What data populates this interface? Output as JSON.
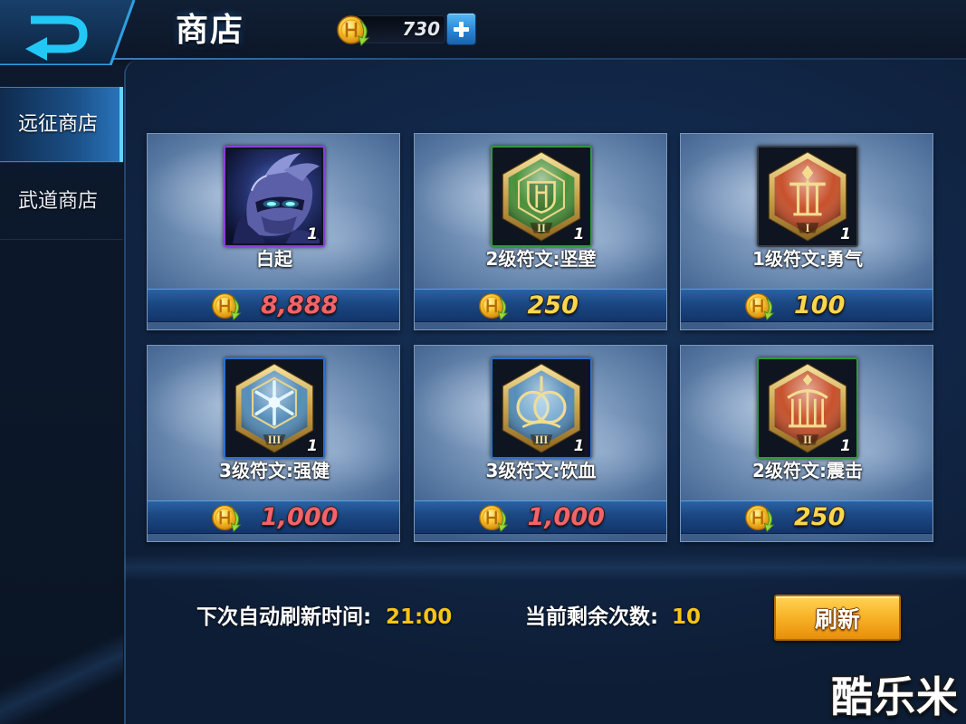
{
  "header": {
    "title": "商店",
    "gold_amount": "730",
    "back_icon": "back-arrow-icon",
    "currency_icon": "gold-coin-icon",
    "add_icon": "plus-icon"
  },
  "sidebar": {
    "tabs": [
      {
        "label": "远征商店",
        "selected": true
      },
      {
        "label": "武道商店",
        "selected": false
      }
    ]
  },
  "shop": {
    "currency_icon": "gold-coin-icon",
    "items": [
      {
        "name": "白起",
        "count": "1",
        "icon": "hero-portrait-icon",
        "frame_color": "#8b3fd6",
        "price": "8,888",
        "price_color": "#f2636b"
      },
      {
        "name": "2级符文:坚壁",
        "count": "1",
        "tier": "II",
        "icon": "green-rune-icon",
        "frame_color": "#2f9a3a",
        "rune_color": "#3f8a2e",
        "price": "250",
        "price_color": "#f6d84e"
      },
      {
        "name": "1级符文:勇气",
        "count": "1",
        "tier": "I",
        "icon": "red-rune-icon",
        "frame_color": "#3a3f48",
        "rune_color": "#c4461e",
        "price": "100",
        "price_color": "#f6d84e"
      },
      {
        "name": "3级符文:强健",
        "count": "1",
        "tier": "III",
        "icon": "blue-rune-icon",
        "frame_color": "#2f6fd0",
        "rune_color": "#4a86b6",
        "price": "1,000",
        "price_color": "#f2636b"
      },
      {
        "name": "3级符文:饮血",
        "count": "1",
        "tier": "III",
        "icon": "blue-rune-icon",
        "frame_color": "#2f6fd0",
        "rune_color": "#4a86b6",
        "price": "1,000",
        "price_color": "#f2636b"
      },
      {
        "name": "2级符文:震击",
        "count": "1",
        "tier": "II",
        "icon": "red-rune-icon",
        "frame_color": "#2f9a3a",
        "rune_color": "#c4461e",
        "price": "250",
        "price_color": "#f6d84e"
      }
    ]
  },
  "footer": {
    "refresh_time_label": "下次自动刷新时间:",
    "refresh_time_value": "21:00",
    "remaining_label": "当前剩余次数:",
    "remaining_value": "10",
    "refresh_button_label": "刷新"
  },
  "watermark": {
    "text": "酷乐米"
  },
  "colors": {
    "value_highlight": "#f6c416"
  }
}
